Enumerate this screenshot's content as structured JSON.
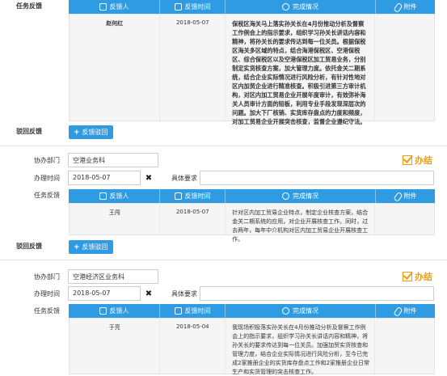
{
  "columns": {
    "person": "反馈人",
    "time": "反馈时间",
    "status": "完成情况",
    "attach": "附件"
  },
  "labels": {
    "task_feedback": "任务反馈",
    "return_feedback": "驳回反馈",
    "collab_dept": "协办部门",
    "handle_time": "办理时间",
    "specific_req": "具体要求",
    "feedback_return_btn": "反馈驳回",
    "done": "办结",
    "clear": "✖"
  },
  "sections": [
    {
      "feedback": {
        "person": "赵何红",
        "time": "2018-05-07",
        "status": "保税区海关马上落实孙关长在4月份推动分析及督察工作例会上的指示要求，组织学习孙关长讲话内容和精神，将孙关长的要求传达到每一位关员。根据保税区海关多区域的特点，结合海港保税区、空港保税区、综合保税区以及空港保税区加工贸易业务，分别制定实货核查方案，加大管理力度。依托金关二期系统，结合企业实际情况进行风险分析，有针对性地对区内加贸企业进行精准核查。积极引进第三方审计机构，对区内加工贸易企业开展年度审计，有效弥补海关人员审计方面的短板，利用专业手段发现深层次的问题。加大下厂核销、实货库存盘点的力度和频度，对加工贸易企业开展突击核查，监督企业遵纪守法。"
      }
    },
    {
      "dept": "空港业务科",
      "date": "2018-05-07",
      "feedback": {
        "person": "王闯",
        "time": "2018-05-07",
        "status": "针对区内加工贸易企业特点，制定企业核查方案，结合金关二期系统的应用，对企业开展核查工作。同时，过去两年，每年中介机构对区内加工贸易企业开展核查工作。"
      }
    },
    {
      "dept": "空港经济区业务科",
      "date": "2018-05-07",
      "feedback": {
        "person": "于亮",
        "time": "2018-05-04",
        "status": "我现场积极落实孙关长在4月份推动分析及督察工作例会上的指示要求，组织学习孙关长讲话内容和精神，将孙关长的要求传达到每一位关员。加强加贸实货核查和管理力度，结合企业实际情况进行风险分析，至今已完成2家推册企业的实货库存盘点工作和2家推册企业日常生产和实货管理的突击核查工作。"
      }
    }
  ]
}
